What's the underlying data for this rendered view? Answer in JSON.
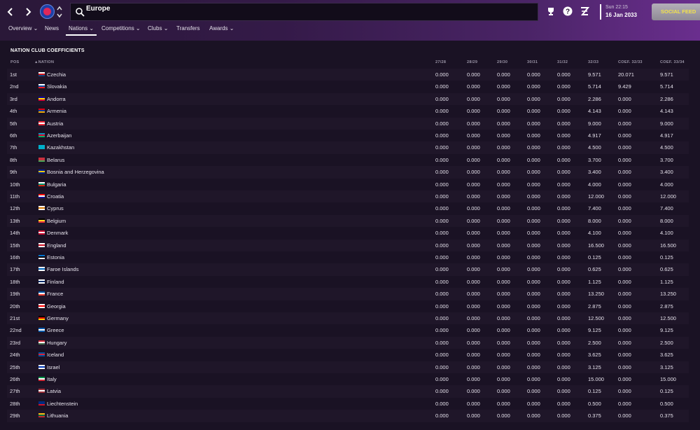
{
  "header": {
    "title": "Europe",
    "date_line1": "Sun 22:15",
    "date_line2": "16 Jan 2033",
    "social_label": "SOCIAL FEED"
  },
  "menu": [
    {
      "label": "Overview",
      "dropdown": true
    },
    {
      "label": "News",
      "dropdown": false
    },
    {
      "label": "Nations",
      "dropdown": true,
      "active": true
    },
    {
      "label": "Competitions",
      "dropdown": true
    },
    {
      "label": "Clubs",
      "dropdown": true
    },
    {
      "label": "Transfers",
      "dropdown": false
    },
    {
      "label": "Awards",
      "dropdown": true
    }
  ],
  "section_title": "NATION CLUB COEFFICIENTS",
  "columns": {
    "pos": "POS",
    "nation": "NATION",
    "c1": "27/28",
    "c2": "28/29",
    "c3": "29/30",
    "c4": "30/31",
    "c5": "31/32",
    "c6": "32/33",
    "c7": "COEF. 32/33",
    "c8": "COEF. 33/34"
  },
  "rows": [
    {
      "pos": "1st",
      "nation": "Czechia",
      "flag": [
        "#ffffff",
        "#d7141a",
        "#11457e"
      ],
      "v": [
        "0.000",
        "0.000",
        "0.000",
        "0.000",
        "0.000",
        "9.571",
        "20.071",
        "9.571"
      ]
    },
    {
      "pos": "2nd",
      "nation": "Slovakia",
      "flag": [
        "#ffffff",
        "#0b4ea2",
        "#ee1c25"
      ],
      "v": [
        "0.000",
        "0.000",
        "0.000",
        "0.000",
        "0.000",
        "5.714",
        "9.429",
        "5.714"
      ]
    },
    {
      "pos": "3rd",
      "nation": "Andorra",
      "flag": [
        "#10069f",
        "#fedd00",
        "#d50032"
      ],
      "v": [
        "0.000",
        "0.000",
        "0.000",
        "0.000",
        "0.000",
        "2.286",
        "0.000",
        "2.286"
      ]
    },
    {
      "pos": "4th",
      "nation": "Armenia",
      "flag": [
        "#d90012",
        "#0033a0",
        "#f2a800"
      ],
      "v": [
        "0.000",
        "0.000",
        "0.000",
        "0.000",
        "0.000",
        "4.143",
        "0.000",
        "4.143"
      ]
    },
    {
      "pos": "5th",
      "nation": "Austria",
      "flag": [
        "#ed2939",
        "#ffffff",
        "#ed2939"
      ],
      "v": [
        "0.000",
        "0.000",
        "0.000",
        "0.000",
        "0.000",
        "9.000",
        "0.000",
        "9.000"
      ]
    },
    {
      "pos": "6th",
      "nation": "Azerbaijan",
      "flag": [
        "#0092bc",
        "#e4002b",
        "#00af66"
      ],
      "v": [
        "0.000",
        "0.000",
        "0.000",
        "0.000",
        "0.000",
        "4.917",
        "0.000",
        "4.917"
      ]
    },
    {
      "pos": "7th",
      "nation": "Kazakhstan",
      "flag": [
        "#00afca",
        "#00afca",
        "#00afca"
      ],
      "v": [
        "0.000",
        "0.000",
        "0.000",
        "0.000",
        "0.000",
        "4.500",
        "0.000",
        "4.500"
      ]
    },
    {
      "pos": "8th",
      "nation": "Belarus",
      "flag": [
        "#c8313e",
        "#c8313e",
        "#4aa657"
      ],
      "v": [
        "0.000",
        "0.000",
        "0.000",
        "0.000",
        "0.000",
        "3.700",
        "0.000",
        "3.700"
      ]
    },
    {
      "pos": "9th",
      "nation": "Bosnia and Herzegovina",
      "flag": [
        "#002395",
        "#fecb00",
        "#002395"
      ],
      "v": [
        "0.000",
        "0.000",
        "0.000",
        "0.000",
        "0.000",
        "3.400",
        "0.000",
        "3.400"
      ]
    },
    {
      "pos": "10th",
      "nation": "Bulgaria",
      "flag": [
        "#ffffff",
        "#00966e",
        "#d62612"
      ],
      "v": [
        "0.000",
        "0.000",
        "0.000",
        "0.000",
        "0.000",
        "4.000",
        "0.000",
        "4.000"
      ]
    },
    {
      "pos": "11th",
      "nation": "Croatia",
      "flag": [
        "#ff0000",
        "#ffffff",
        "#171796"
      ],
      "v": [
        "0.000",
        "0.000",
        "0.000",
        "0.000",
        "0.000",
        "12.000",
        "0.000",
        "12.000"
      ]
    },
    {
      "pos": "12th",
      "nation": "Cyprus",
      "flag": [
        "#ffffff",
        "#d57800",
        "#ffffff"
      ],
      "v": [
        "0.000",
        "0.000",
        "0.000",
        "0.000",
        "0.000",
        "7.400",
        "0.000",
        "7.400"
      ]
    },
    {
      "pos": "13th",
      "nation": "Belgium",
      "flag": [
        "#000000",
        "#fdda24",
        "#ef3340"
      ],
      "v": [
        "0.000",
        "0.000",
        "0.000",
        "0.000",
        "0.000",
        "8.000",
        "0.000",
        "8.000"
      ]
    },
    {
      "pos": "14th",
      "nation": "Denmark",
      "flag": [
        "#c60c30",
        "#ffffff",
        "#c60c30"
      ],
      "v": [
        "0.000",
        "0.000",
        "0.000",
        "0.000",
        "0.000",
        "4.100",
        "0.000",
        "4.100"
      ]
    },
    {
      "pos": "15th",
      "nation": "England",
      "flag": [
        "#ffffff",
        "#ce1124",
        "#ffffff"
      ],
      "v": [
        "0.000",
        "0.000",
        "0.000",
        "0.000",
        "0.000",
        "16.500",
        "0.000",
        "16.500"
      ]
    },
    {
      "pos": "16th",
      "nation": "Estonia",
      "flag": [
        "#0072ce",
        "#000000",
        "#ffffff"
      ],
      "v": [
        "0.000",
        "0.000",
        "0.000",
        "0.000",
        "0.000",
        "0.125",
        "0.000",
        "0.125"
      ]
    },
    {
      "pos": "17th",
      "nation": "Faroe Islands",
      "flag": [
        "#ffffff",
        "#0065bd",
        "#ffffff"
      ],
      "v": [
        "0.000",
        "0.000",
        "0.000",
        "0.000",
        "0.000",
        "0.625",
        "0.000",
        "0.625"
      ]
    },
    {
      "pos": "18th",
      "nation": "Finland",
      "flag": [
        "#ffffff",
        "#002f6c",
        "#ffffff"
      ],
      "v": [
        "0.000",
        "0.000",
        "0.000",
        "0.000",
        "0.000",
        "1.125",
        "0.000",
        "1.125"
      ]
    },
    {
      "pos": "19th",
      "nation": "France",
      "flag": [
        "#0055a4",
        "#ffffff",
        "#ef4135"
      ],
      "v": [
        "0.000",
        "0.000",
        "0.000",
        "0.000",
        "0.000",
        "13.250",
        "0.000",
        "13.250"
      ]
    },
    {
      "pos": "20th",
      "nation": "Georgia",
      "flag": [
        "#ffffff",
        "#ff0000",
        "#ffffff"
      ],
      "v": [
        "0.000",
        "0.000",
        "0.000",
        "0.000",
        "0.000",
        "2.875",
        "0.000",
        "2.875"
      ]
    },
    {
      "pos": "21st",
      "nation": "Germany",
      "flag": [
        "#000000",
        "#dd0000",
        "#ffce00"
      ],
      "v": [
        "0.000",
        "0.000",
        "0.000",
        "0.000",
        "0.000",
        "12.500",
        "0.000",
        "12.500"
      ]
    },
    {
      "pos": "22nd",
      "nation": "Greece",
      "flag": [
        "#0d5eaf",
        "#ffffff",
        "#0d5eaf"
      ],
      "v": [
        "0.000",
        "0.000",
        "0.000",
        "0.000",
        "0.000",
        "9.125",
        "0.000",
        "9.125"
      ]
    },
    {
      "pos": "23rd",
      "nation": "Hungary",
      "flag": [
        "#ce2939",
        "#ffffff",
        "#477050"
      ],
      "v": [
        "0.000",
        "0.000",
        "0.000",
        "0.000",
        "0.000",
        "2.500",
        "0.000",
        "2.500"
      ]
    },
    {
      "pos": "24th",
      "nation": "Iceland",
      "flag": [
        "#02529c",
        "#dc1e35",
        "#02529c"
      ],
      "v": [
        "0.000",
        "0.000",
        "0.000",
        "0.000",
        "0.000",
        "3.625",
        "0.000",
        "3.625"
      ]
    },
    {
      "pos": "25th",
      "nation": "Israel",
      "flag": [
        "#ffffff",
        "#0038b8",
        "#ffffff"
      ],
      "v": [
        "0.000",
        "0.000",
        "0.000",
        "0.000",
        "0.000",
        "3.125",
        "0.000",
        "3.125"
      ]
    },
    {
      "pos": "26th",
      "nation": "Italy",
      "flag": [
        "#009246",
        "#ffffff",
        "#ce2b37"
      ],
      "v": [
        "0.000",
        "0.000",
        "0.000",
        "0.000",
        "0.000",
        "15.000",
        "0.000",
        "15.000"
      ]
    },
    {
      "pos": "27th",
      "nation": "Latvia",
      "flag": [
        "#9e3039",
        "#ffffff",
        "#9e3039"
      ],
      "v": [
        "0.000",
        "0.000",
        "0.000",
        "0.000",
        "0.000",
        "0.125",
        "0.000",
        "0.125"
      ]
    },
    {
      "pos": "28th",
      "nation": "Liechtenstein",
      "flag": [
        "#002b7f",
        "#002b7f",
        "#ce1126"
      ],
      "v": [
        "0.000",
        "0.000",
        "0.000",
        "0.000",
        "0.000",
        "0.500",
        "0.000",
        "0.500"
      ]
    },
    {
      "pos": "29th",
      "nation": "Lithuania",
      "flag": [
        "#fdb913",
        "#006a44",
        "#c1272d"
      ],
      "v": [
        "0.000",
        "0.000",
        "0.000",
        "0.000",
        "0.000",
        "0.375",
        "0.000",
        "0.375"
      ]
    }
  ]
}
